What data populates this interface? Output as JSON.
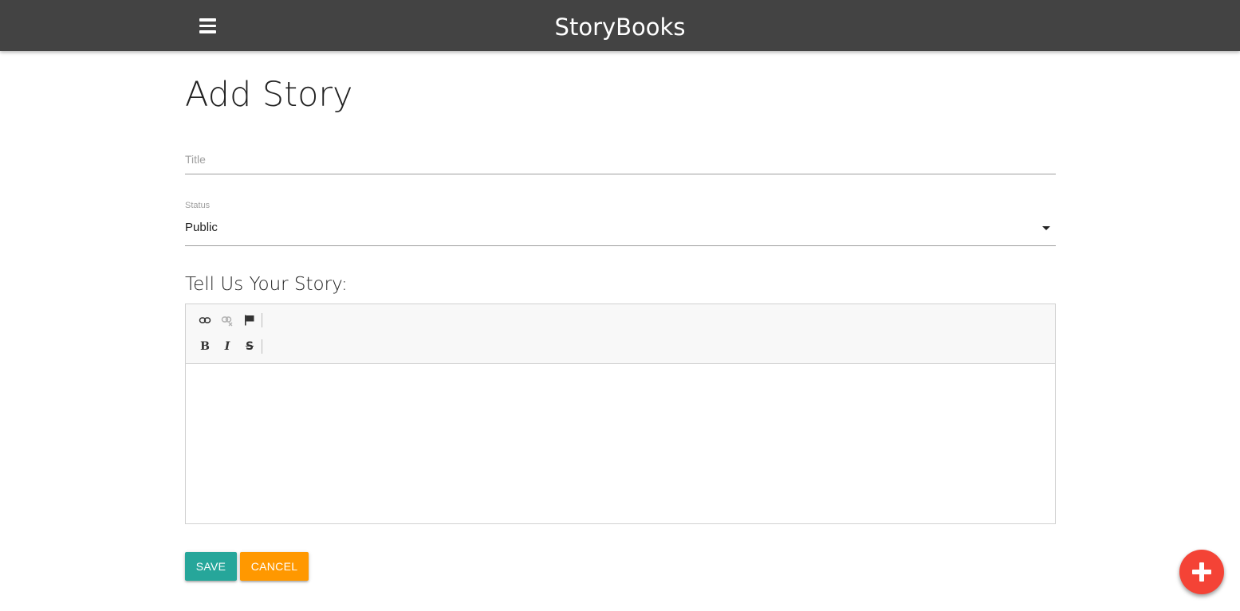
{
  "navbar": {
    "brand": "StoryBooks",
    "menu_icon": "hamburger-menu-icon"
  },
  "page": {
    "title": "Add Story"
  },
  "form": {
    "title_field": {
      "placeholder": "Title",
      "value": ""
    },
    "status_field": {
      "label": "Status",
      "selected": "Public"
    },
    "story_heading": "Tell Us Your Story:",
    "editor": {
      "toolbar_row1": [
        "link-icon",
        "unlink-icon",
        "anchor-flag-icon"
      ],
      "toolbar_row2": {
        "bold": "B",
        "italic": "I",
        "strike": "S"
      },
      "body": ""
    },
    "save_label": "Save",
    "cancel_label": "Cancel"
  },
  "fab": {
    "icon": "add-icon"
  },
  "colors": {
    "navbar_bg": "#434343",
    "save_bg": "#26a69a",
    "cancel_bg": "#ff9800",
    "fab_bg": "#f44336"
  }
}
